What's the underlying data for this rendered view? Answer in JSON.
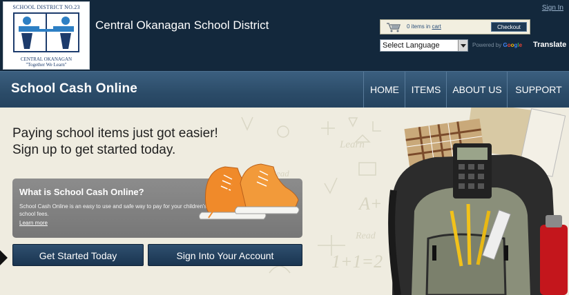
{
  "header": {
    "logo": {
      "top_text": "SCHOOL DISTRICT NO.23",
      "bottom_text": "CENTRAL OKANAGAN",
      "motto": "\"Together We Learn\""
    },
    "district_name": "Central Okanagan School District",
    "sign_in": "Sign In",
    "cart": {
      "count_text": "0 items in",
      "cart_link": "cart",
      "checkout_label": "Checkout"
    },
    "language": {
      "selected": "Select Language",
      "powered_by": "Powered by",
      "google": "Google",
      "translate": "Translate"
    }
  },
  "nav": {
    "brand": "School Cash Online",
    "items": [
      {
        "label": "HOME"
      },
      {
        "label": "ITEMS"
      },
      {
        "label": "ABOUT US"
      },
      {
        "label": "SUPPORT"
      }
    ]
  },
  "hero": {
    "headline_line1": "Paying school items just got easier!",
    "headline_line2": "Sign up to get started today.",
    "info_title": "What is School Cash Online?",
    "info_body": "School Cash Online is an easy to use and safe way to pay for your children's school fees.",
    "info_link": "Learn more",
    "get_started": "Get Started Today",
    "sign_into": "Sign Into Your Account",
    "doodles": [
      "Learn",
      "Read",
      "A+",
      "Read",
      "1+1=2"
    ]
  },
  "colors": {
    "header_bg": "#13283c",
    "nav_bg": "#2b4b68",
    "hero_bg": "#efece0",
    "button_bg": "#1f3d5b",
    "shoe_orange": "#f08a2a"
  }
}
